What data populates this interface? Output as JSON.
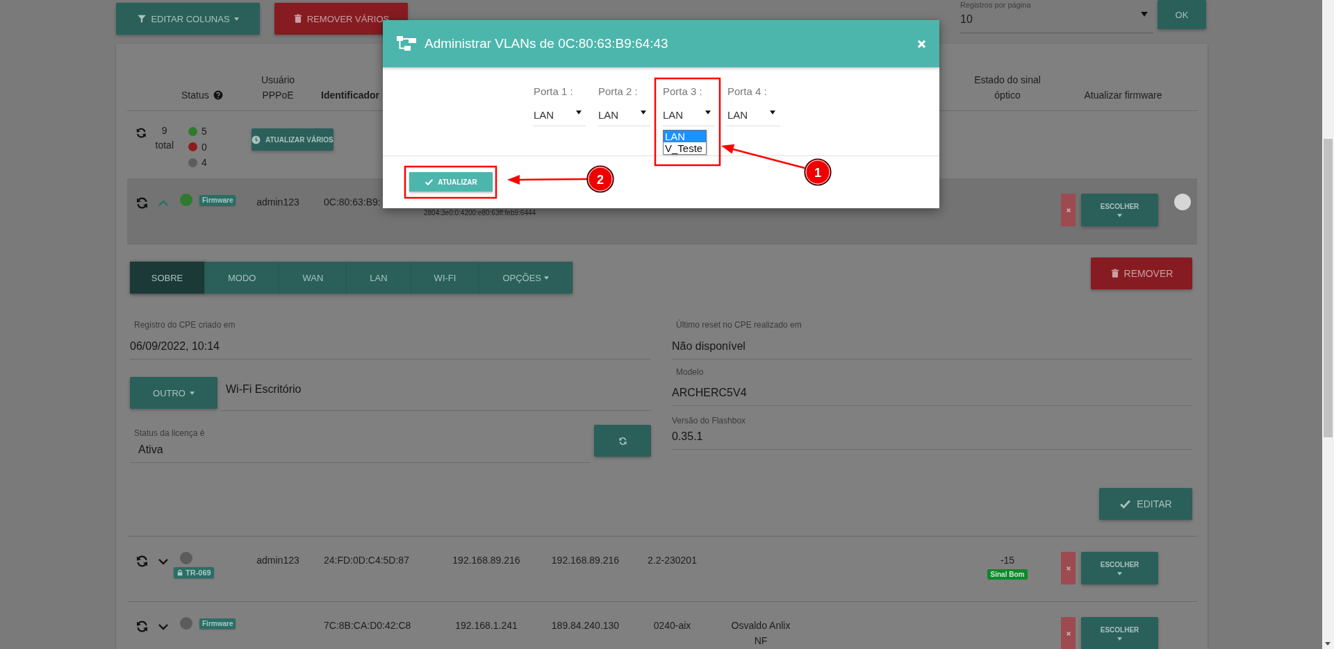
{
  "toolbar": {
    "buttons": [
      {
        "kind": "filter",
        "label": "EDITAR COLUNAS"
      },
      {
        "kind": "danger",
        "label": "REMOVER VÁRIOS"
      }
    ],
    "page_size": {
      "label": "Registros por página",
      "value": "10"
    },
    "ok_button": "OK"
  },
  "table": {
    "columns": [
      {
        "label": "Status",
        "help": true
      },
      {
        "label": "Usuário PPPoE",
        "help": false
      },
      {
        "label": "Identificador",
        "help": false
      },
      {
        "label": "Estado do sinal óptico",
        "help": false
      },
      {
        "label": "Atualizar firmware",
        "help": false
      }
    ],
    "summary": {
      "total": "9",
      "total_label": "total",
      "status_counts": [
        {
          "count": "5",
          "color": "#2e7a2e"
        },
        {
          "count": "0",
          "color": "#8e1c1c"
        },
        {
          "count": "4",
          "color": "#5c5c5c"
        }
      ],
      "bulk_button": "ATUALIZAR VÁRIOS"
    },
    "rows": [
      {
        "expanded": true,
        "color": "#2e7a2e",
        "badge": {
          "label": "Firmware",
          "locked": false
        },
        "user": "admin123",
        "identifier": "0C:80:63:B9:",
        "ipv6": "2804:3e0:0:4200:e80:63ff:feb9:6444",
        "choose_button": "ESCOLHER",
        "details": {
          "tabs": [
            {
              "label": "SOBRE",
              "selected": true,
              "kind": "plain"
            },
            {
              "label": "MODO",
              "selected": false,
              "kind": "plain"
            },
            {
              "label": "WAN",
              "selected": false,
              "kind": "plain"
            },
            {
              "label": "LAN",
              "selected": false,
              "kind": "plain"
            },
            {
              "label": "WI-FI",
              "selected": false,
              "kind": "plain"
            },
            {
              "label": "OPÇÕES",
              "selected": false,
              "kind": "dropdown"
            }
          ],
          "remove_button": "REMOVER",
          "created": {
            "label": "Registro do CPE criado em",
            "value": "06/09/2022, 10:14"
          },
          "name_type_button": "OUTRO",
          "name_value": "Wi-Fi Escritório",
          "license": {
            "label": "Status da licença é",
            "value": "Ativa"
          },
          "last_reset": {
            "label": "Último reset no CPE realizado em",
            "value": "Não disponível"
          },
          "model": {
            "label": "Modelo",
            "value": "ARCHERC5V4"
          },
          "flashbox_version": {
            "label": "Versão do Flashbox",
            "value": "0.35.1"
          },
          "edit_button": "EDITAR"
        }
      },
      {
        "expanded": false,
        "color": "#5c5c5c",
        "badge": {
          "label": "TR-069",
          "locked": true
        },
        "user": "admin123",
        "identifier": "24:FD:0D:C4:5D:87",
        "lan_ip": "192.168.89.216",
        "wan_ip": "192.168.89.216",
        "version": "2.2-230201",
        "signal": {
          "value": "-15",
          "label": "Sinal Bom"
        },
        "choose_button": "ESCOLHER"
      },
      {
        "expanded": false,
        "color": "#5c5c5c",
        "badge": {
          "label": "Firmware",
          "locked": false
        },
        "identifier": "7C:8B:CA:D0:42:C8",
        "lan_ip": "192.168.1.241",
        "wan_ip": "189.84.240.130",
        "version": "0240-aix",
        "client": "Osvaldo Anlix NF",
        "choose_button": "ESCOLHER"
      }
    ]
  },
  "modal": {
    "title": "Administrar VLANs de 0C:80:63:B9:64:43",
    "ports": [
      {
        "label": "Porta 1 :",
        "value": "LAN",
        "open": false
      },
      {
        "label": "Porta 2 :",
        "value": "LAN",
        "open": false
      },
      {
        "label": "Porta 3 :",
        "value": "LAN",
        "open": true,
        "options": [
          {
            "label": "LAN",
            "selected": true
          },
          {
            "label": "V_Teste",
            "selected": false
          }
        ]
      },
      {
        "label": "Porta 4 :",
        "value": "LAN",
        "open": false
      }
    ],
    "submit_button": "ATUALIZAR"
  },
  "annotations": [
    {
      "number": "1"
    },
    {
      "number": "2"
    }
  ]
}
